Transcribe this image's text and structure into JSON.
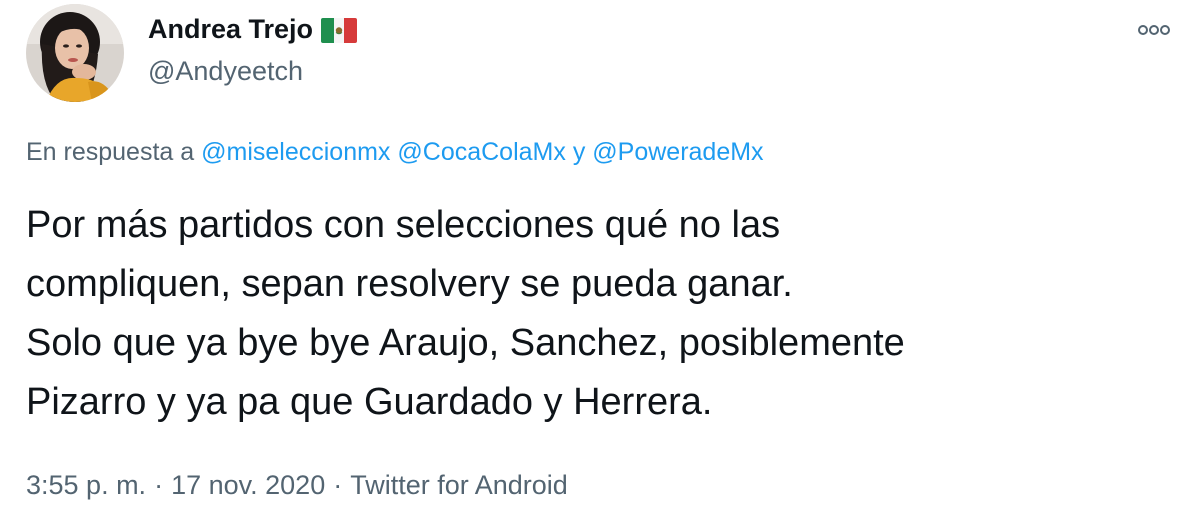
{
  "author": {
    "display_name": "Andrea Trejo",
    "handle": "@Andyeetch",
    "flag_icon": "mexico-flag-icon",
    "avatar_icon": "user-avatar-photo"
  },
  "reply": {
    "prefix": "En respuesta a",
    "mentions": [
      "@miseleccionmx",
      "@CocaColaMx",
      "@PoweradeMx"
    ],
    "conjunction": "y"
  },
  "tweet": {
    "lines": [
      "Por más partidos con selecciones qué no las",
      "compliquen, sepan resolvery se pueda ganar.",
      "Solo que ya bye bye Araujo, Sanchez, posiblemente",
      "Pizarro y ya pa que Guardado y Herrera."
    ]
  },
  "meta": {
    "time": "3:55 p. m.",
    "separator": "·",
    "date": "17 nov. 2020",
    "source": "Twitter for Android"
  },
  "menu": {
    "icon": "more-options-icon"
  },
  "colors": {
    "text": "#0f1419",
    "secondary": "#536471",
    "link": "#1d9bf0"
  }
}
